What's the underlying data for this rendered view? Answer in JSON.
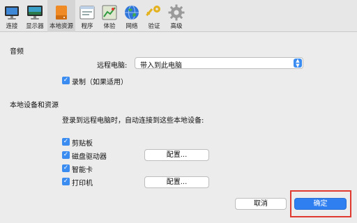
{
  "toolbar": {
    "items": [
      {
        "label": "连接",
        "icon": "connect-icon"
      },
      {
        "label": "显示器",
        "icon": "monitor-icon"
      },
      {
        "label": "本地资源",
        "icon": "local-resources-icon"
      },
      {
        "label": "程序",
        "icon": "programs-icon"
      },
      {
        "label": "体验",
        "icon": "experience-icon"
      },
      {
        "label": "网络",
        "icon": "network-globe-icon"
      },
      {
        "label": "验证",
        "icon": "key-icon"
      },
      {
        "label": "高级",
        "icon": "gear-icon"
      }
    ],
    "active_index": 2
  },
  "audio": {
    "section_title": "音频",
    "remote_label": "远程电脑:",
    "remote_value": "带入到此电脑",
    "record_label": "录制（如果适用）",
    "record_checked": true
  },
  "devices": {
    "section_title": "本地设备和资源",
    "intro": "登录到远程电脑时，自动连接到这些本地设备:",
    "items": [
      {
        "label": "剪贴板",
        "checked": true,
        "button": ""
      },
      {
        "label": "磁盘驱动器",
        "checked": true,
        "button": "配置..."
      },
      {
        "label": "智能卡",
        "checked": true,
        "button": ""
      },
      {
        "label": "打印机",
        "checked": true,
        "button": "配置..."
      }
    ]
  },
  "footer": {
    "cancel_label": "取消",
    "ok_label": "确定"
  },
  "colors": {
    "accent": "#3b8cf0",
    "primary_button": "#2f7ff0",
    "highlight_border": "#e0392f"
  }
}
